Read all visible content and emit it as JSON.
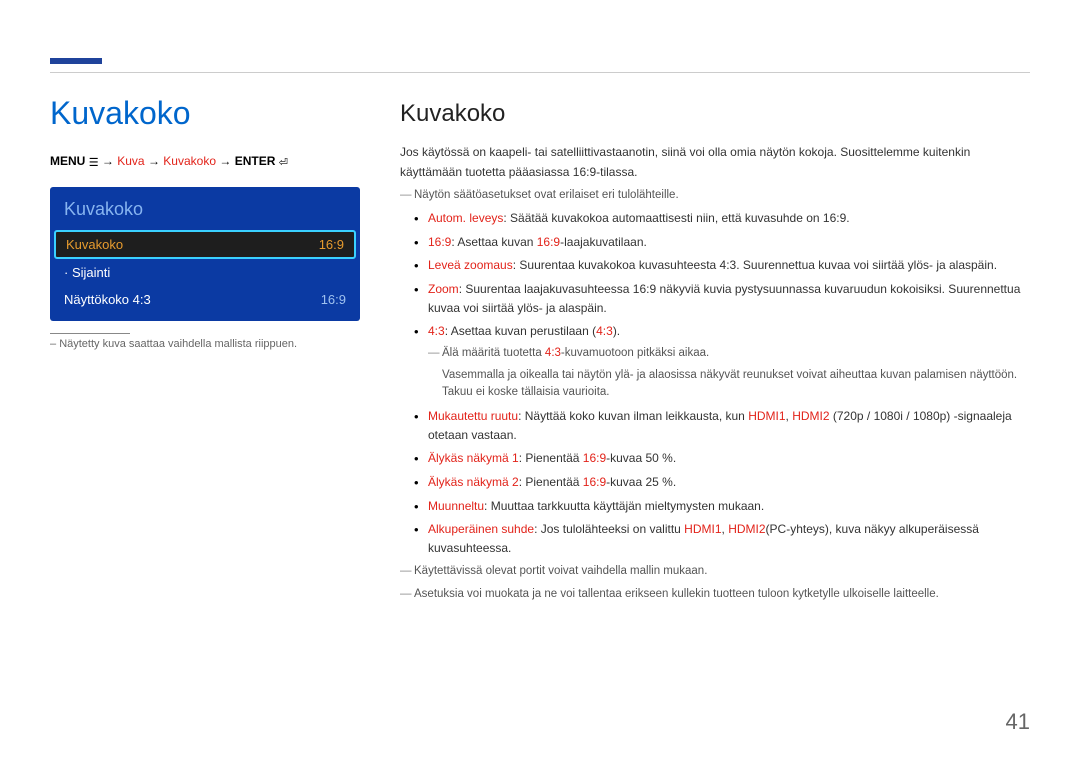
{
  "page_number": "41",
  "left": {
    "title": "Kuvakoko",
    "breadcrumb": {
      "menu_label": "MENU",
      "menu_icon": "☰",
      "parts": [
        "Kuva",
        "Kuvakoko"
      ],
      "enter_label": "ENTER",
      "enter_icon": "⏎"
    },
    "menu": {
      "title": "Kuvakoko",
      "rows": [
        {
          "label": "Kuvakoko",
          "value": "16:9",
          "selected": true
        },
        {
          "label": "· Sijainti",
          "value": "",
          "selected": false
        },
        {
          "label": "Näyttökoko 4:3",
          "value": "16:9",
          "selected": false
        }
      ]
    },
    "footnote": "Näytetty kuva saattaa vaihdella mallista riippuen."
  },
  "right": {
    "title": "Kuvakoko",
    "intro1": "Jos käytössä on kaapeli- tai satelliittivastaanotin, siinä voi olla omia näytön kokoja. Suosittelemme kuitenkin käyttämään tuotetta pääasiassa 16:9-tilassa.",
    "note1": "Näytön säätöasetukset ovat erilaiset eri tulolähteille.",
    "bullets": {
      "autom_label": "Autom. leveys",
      "autom_text": ": Säätää kuvakokoa automaattisesti niin, että kuvasuhde on 16:9.",
      "b169_label": "16:9",
      "b169_text_a": ": Asettaa kuvan ",
      "b169_kw": "16:9",
      "b169_text_b": "-laajakuvatilaan.",
      "zoomL_label": "Leveä zoomaus",
      "zoomL_text": ": Suurentaa kuvakokoa kuvasuhteesta 4:3. Suurennettua kuvaa voi siirtää ylös- ja alaspäin.",
      "zoom_label": "Zoom",
      "zoom_text": ": Suurentaa laajakuvasuhteessa 16:9 näkyviä kuvia pystysuunnassa kuvaruudun kokoisiksi. Suurennettua kuvaa voi siirtää ylös- ja alaspäin.",
      "b43_label": "4:3",
      "b43_text_a": ": Asettaa kuvan perustilaan (",
      "b43_kw": "4:3",
      "b43_text_b": ").",
      "b43_note1": "Älä määritä tuotetta ",
      "b43_note1_kw": "4:3",
      "b43_note1_b": "-kuvamuotoon pitkäksi aikaa.",
      "b43_note2": "Vasemmalla ja oikealla tai näytön ylä- ja alaosissa näkyvät reunukset voivat aiheuttaa kuvan palamisen näyttöön. Takuu ei koske tällaisia vaurioita.",
      "muk_label": "Mukautettu ruutu",
      "muk_text_a": ": Näyttää koko kuvan ilman leikkausta, kun ",
      "muk_hdmi1": "HDMI1",
      "muk_comma": ", ",
      "muk_hdmi2": "HDMI2",
      "muk_text_b": " (720p / 1080i / 1080p) -signaaleja otetaan vastaan.",
      "alyk1_label": "Älykäs näkymä 1",
      "alyk1_text_a": ": Pienentää ",
      "alyk1_kw": "16:9",
      "alyk1_text_b": "-kuvaa 50 %.",
      "alyk2_label": "Älykäs näkymä 2",
      "alyk2_text_a": ": Pienentää ",
      "alyk2_kw": "16:9",
      "alyk2_text_b": "-kuvaa 25 %.",
      "muun_label": "Muunneltu",
      "muun_text": ": Muuttaa tarkkuutta käyttäjän mieltymysten mukaan.",
      "alku_label": "Alkuperäinen suhde",
      "alku_text_a": ": Jos tulolähteeksi on valittu ",
      "alku_hdmi1": "HDMI1",
      "alku_comma": ", ",
      "alku_hdmi2": "HDMI2",
      "alku_text_b": "(PC-yhteys), kuva näkyy alkuperäisessä kuvasuhteessa."
    },
    "note2": "Käytettävissä olevat portit voivat vaihdella mallin mukaan.",
    "note3": "Asetuksia voi muokata ja ne voi tallentaa erikseen kullekin tuotteen tuloon kytketylle ulkoiselle laitteelle."
  }
}
